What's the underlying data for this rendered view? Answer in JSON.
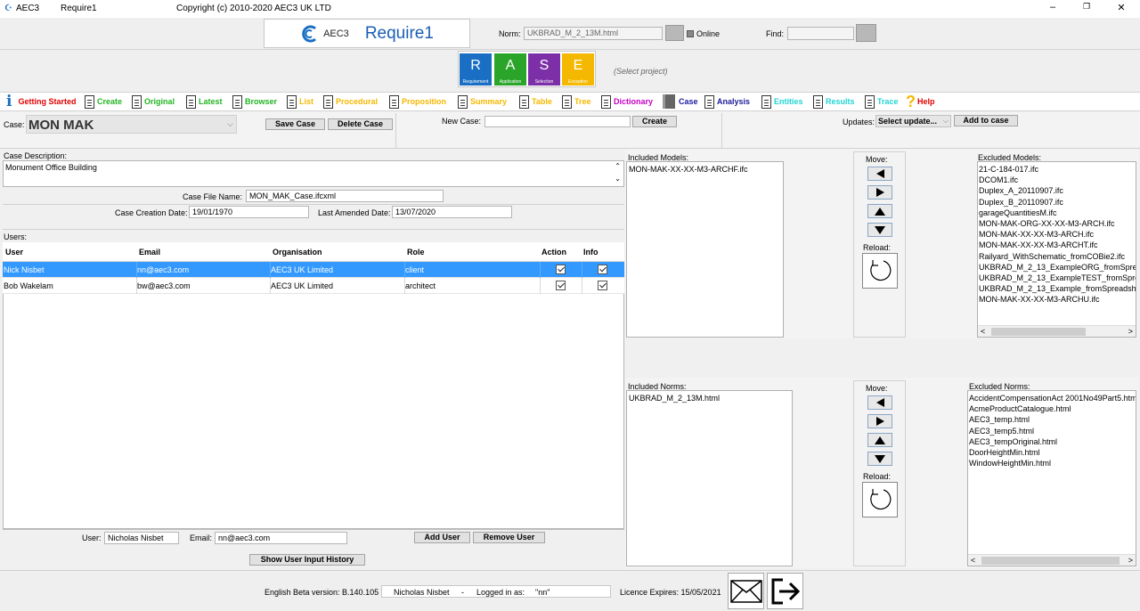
{
  "titlebar": {
    "app": "AEC3",
    "module": "Require1",
    "copyright": "Copyright (c) 2010-2020  AEC3 UK LTD",
    "minimize": "–",
    "restore": "❐",
    "close": "✕"
  },
  "header": {
    "logo_brand": "AEC3",
    "logo_product": "Require1",
    "norm_label": "Norm:",
    "norm_value": "UKBRAD_M_2_13M.html",
    "online_label": "Online",
    "find_label": "Find:",
    "find_value": ""
  },
  "rase": {
    "tiles": [
      {
        "letter": "R",
        "caption": "Requirement",
        "color": "#1a6fc4"
      },
      {
        "letter": "A",
        "caption": "Application",
        "color": "#2aa52a"
      },
      {
        "letter": "S",
        "caption": "Selection",
        "color": "#7d2fa8"
      },
      {
        "letter": "E",
        "caption": "Exception",
        "color": "#f5b800"
      }
    ],
    "select_project": "(Select project)"
  },
  "menu": {
    "items": [
      {
        "label": "Getting Started",
        "color": "#e00000"
      },
      {
        "label": "Create",
        "color": "#22b522"
      },
      {
        "label": "Original",
        "color": "#22b522"
      },
      {
        "label": "Latest",
        "color": "#22b522"
      },
      {
        "label": "Browser",
        "color": "#22b522"
      },
      {
        "label": "List",
        "color": "#f5b800"
      },
      {
        "label": "Procedural",
        "color": "#f5b800"
      },
      {
        "label": "Proposition",
        "color": "#f5b800"
      },
      {
        "label": "Summary",
        "color": "#f5b800"
      },
      {
        "label": "Table",
        "color": "#f5b800"
      },
      {
        "label": "Tree",
        "color": "#f5b800"
      },
      {
        "label": "Dictionary",
        "color": "#c400c4"
      },
      {
        "label": "Case",
        "color": "#1a1a9c"
      },
      {
        "label": "Analysis",
        "color": "#1a1a9c"
      },
      {
        "label": "Entities",
        "color": "#22d4d4"
      },
      {
        "label": "Results",
        "color": "#22d4d4"
      },
      {
        "label": "Trace",
        "color": "#22d4d4"
      },
      {
        "label": "Help",
        "color": "#e00000"
      }
    ]
  },
  "case_bar": {
    "case_label": "Case:",
    "case_value": "MON MAK",
    "save_case": "Save Case",
    "delete_case": "Delete Case",
    "new_case_label": "New Case:",
    "new_case_value": "",
    "create": "Create",
    "updates_label": "Updates:",
    "updates_value": "Select update...",
    "add_to_case": "Add to case"
  },
  "case_details": {
    "description_label": "Case Description:",
    "description_value": "Monument Office Building",
    "file_name_label": "Case File Name:",
    "file_name_value": "MON_MAK_Case.ifcxml",
    "creation_date_label": "Case Creation Date:",
    "creation_date_value": "19/01/1970",
    "amended_date_label": "Last Amended Date:",
    "amended_date_value": "13/07/2020"
  },
  "users": {
    "label": "Users:",
    "columns": [
      "User",
      "Email",
      "Organisation",
      "Role",
      "Action",
      "Info"
    ],
    "rows": [
      {
        "user": "Nick Nisbet",
        "email": "nn@aec3.com",
        "organisation": "AEC3 UK Limited",
        "role": "client",
        "action": true,
        "info": true
      },
      {
        "user": "Bob Wakelam",
        "email": "bw@aec3.com",
        "organisation": "AEC3 UK Limited",
        "role": "architect",
        "action": true,
        "info": true
      }
    ],
    "user_label": "User:",
    "user_value": "Nicholas Nisbet",
    "email_label": "Email:",
    "email_value": "nn@aec3.com",
    "add_user": "Add User",
    "remove_user": "Remove User",
    "history": "Show User Input History"
  },
  "models": {
    "included_label": "Included Models:",
    "included": [
      "MON-MAK-XX-XX-M3-ARCHF.ifc"
    ],
    "move_label": "Move:",
    "reload_label": "Reload:",
    "excluded_label": "Excluded Models:",
    "excluded": [
      "21-C-184-017.ifc",
      "DCOM1.ifc",
      "Duplex_A_20110907.ifc",
      "Duplex_B_20110907.ifc",
      "garageQuantitiesM.ifc",
      "MON-MAK-ORG-XX-XX-M3-ARCH.ifc",
      "MON-MAK-XX-XX-M3-ARCH.ifc",
      "MON-MAK-XX-XX-M3-ARCHT.ifc",
      "Railyard_WithSchematic_fromCOBie2.ifc",
      "UKBRAD_M_2_13_ExampleORG_fromSpre",
      "UKBRAD_M_2_13_ExampleTEST_fromSpre",
      "UKBRAD_M_2_13_Example_fromSpreadsh",
      "MON-MAK-XX-XX-M3-ARCHU.ifc"
    ]
  },
  "norms": {
    "included_label": "Included Norms:",
    "included": [
      "UKBRAD_M_2_13M.html"
    ],
    "move_label": "Move:",
    "reload_label": "Reload:",
    "excluded_label": "Excluded Norms:",
    "excluded": [
      "AccidentCompensationAct 2001No49Part5.htm",
      "AcmeProductCatalogue.html",
      "AEC3_temp.html",
      "AEC3_temp5.html",
      "AEC3_tempOriginal.html",
      "DoorHeightMin.html",
      "WindowHeightMin.html"
    ]
  },
  "footer": {
    "version": "English Beta version: B.140.105",
    "user": "Nicholas Nisbet",
    "separator": "-",
    "logged_in_label": "Logged in as:",
    "logged_in_value": "\"nn\"",
    "licence": "Licence Expires: 15/05/2021"
  }
}
